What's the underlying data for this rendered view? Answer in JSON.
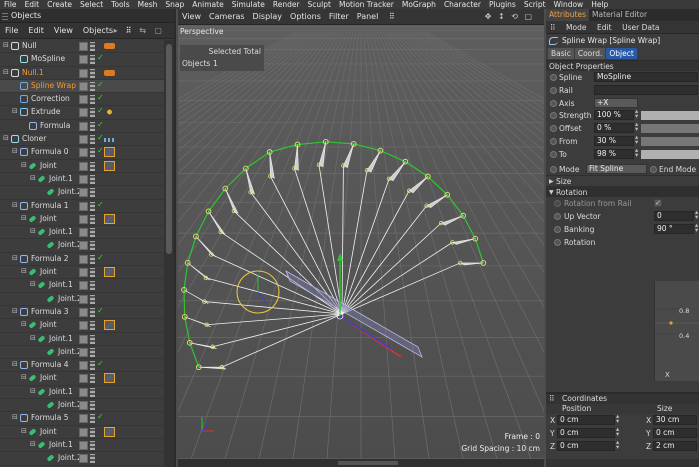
{
  "menubar": [
    "File",
    "Edit",
    "Create",
    "Select",
    "Tools",
    "Mesh",
    "Snap",
    "Animate",
    "Simulate",
    "Render",
    "Sculpt",
    "Motion Tracker",
    "MoGraph",
    "Character",
    "Plugins",
    "Script",
    "Window",
    "Help"
  ],
  "objects_panel": {
    "title": "Objects",
    "menu": [
      "File",
      "Edit",
      "View",
      "Objects"
    ],
    "rows": [
      {
        "label": "Null",
        "indent": 0,
        "icon": "null-icon",
        "expand": "-",
        "tag": "layer-tag",
        "check": false
      },
      {
        "label": "MoSpline",
        "indent": 1,
        "icon": "mospline-icon",
        "expand": "",
        "tag": "",
        "check": true
      },
      {
        "label": "Null.1",
        "indent": 0,
        "icon": "null-icon",
        "expand": "-",
        "tag": "layer-tag",
        "check": false,
        "orange": true
      },
      {
        "label": "Spline Wrap",
        "indent": 1,
        "icon": "spline-wrap-icon",
        "expand": "",
        "tag": "",
        "check": true,
        "orange": true,
        "selected": true
      },
      {
        "label": "Correction",
        "indent": 1,
        "icon": "correction-icon",
        "expand": "",
        "tag": "",
        "check": true
      },
      {
        "label": "Extrude",
        "indent": 1,
        "icon": "extrude-icon",
        "expand": "-",
        "tag": "phong-tag",
        "check": true
      },
      {
        "label": "Formula",
        "indent": 2,
        "icon": "formula-icon",
        "expand": "",
        "tag": "",
        "check": true
      },
      {
        "label": "Cloner",
        "indent": 0,
        "icon": "cloner-icon",
        "expand": "-",
        "tag": "mograph-tag",
        "check": true
      },
      {
        "label": "Formula 0",
        "indent": 1,
        "icon": "formula-icon",
        "expand": "-",
        "tag": "ik-tag",
        "check": true
      },
      {
        "label": "Joint",
        "indent": 2,
        "icon": "joint-icon",
        "expand": "-",
        "tag": "ik-tag",
        "check": false
      },
      {
        "label": "Joint.1",
        "indent": 3,
        "icon": "joint-icon",
        "expand": "-",
        "tag": "",
        "check": false
      },
      {
        "label": "Joint.2",
        "indent": 4,
        "icon": "joint-icon",
        "expand": "",
        "tag": "",
        "check": false
      },
      {
        "label": "Formula 1",
        "indent": 1,
        "icon": "formula-icon",
        "expand": "-",
        "tag": "",
        "check": true
      },
      {
        "label": "Joint",
        "indent": 2,
        "icon": "joint-icon",
        "expand": "-",
        "tag": "ik-tag",
        "check": false
      },
      {
        "label": "Joint.1",
        "indent": 3,
        "icon": "joint-icon",
        "expand": "-",
        "tag": "",
        "check": false
      },
      {
        "label": "Joint.2",
        "indent": 4,
        "icon": "joint-icon",
        "expand": "",
        "tag": "",
        "check": false
      },
      {
        "label": "Formula 2",
        "indent": 1,
        "icon": "formula-icon",
        "expand": "-",
        "tag": "",
        "check": true
      },
      {
        "label": "Joint",
        "indent": 2,
        "icon": "joint-icon",
        "expand": "-",
        "tag": "ik-tag",
        "check": false
      },
      {
        "label": "Joint.1",
        "indent": 3,
        "icon": "joint-icon",
        "expand": "-",
        "tag": "",
        "check": false
      },
      {
        "label": "Joint.2",
        "indent": 4,
        "icon": "joint-icon",
        "expand": "",
        "tag": "",
        "check": false
      },
      {
        "label": "Formula 3",
        "indent": 1,
        "icon": "formula-icon",
        "expand": "-",
        "tag": "",
        "check": true
      },
      {
        "label": "Joint",
        "indent": 2,
        "icon": "joint-icon",
        "expand": "-",
        "tag": "ik-tag",
        "check": false
      },
      {
        "label": "Joint.1",
        "indent": 3,
        "icon": "joint-icon",
        "expand": "-",
        "tag": "",
        "check": false
      },
      {
        "label": "Joint.2",
        "indent": 4,
        "icon": "joint-icon",
        "expand": "",
        "tag": "",
        "check": false
      },
      {
        "label": "Formula 4",
        "indent": 1,
        "icon": "formula-icon",
        "expand": "-",
        "tag": "",
        "check": true
      },
      {
        "label": "Joint",
        "indent": 2,
        "icon": "joint-icon",
        "expand": "-",
        "tag": "ik-tag",
        "check": false
      },
      {
        "label": "Joint.1",
        "indent": 3,
        "icon": "joint-icon",
        "expand": "-",
        "tag": "",
        "check": false
      },
      {
        "label": "Joint.2",
        "indent": 4,
        "icon": "joint-icon",
        "expand": "",
        "tag": "",
        "check": false
      },
      {
        "label": "Formula 5",
        "indent": 1,
        "icon": "formula-icon",
        "expand": "-",
        "tag": "",
        "check": true
      },
      {
        "label": "Joint",
        "indent": 2,
        "icon": "joint-icon",
        "expand": "-",
        "tag": "ik-tag",
        "check": false
      },
      {
        "label": "Joint.1",
        "indent": 3,
        "icon": "joint-icon",
        "expand": "-",
        "tag": "",
        "check": false
      },
      {
        "label": "Joint.2",
        "indent": 4,
        "icon": "joint-icon",
        "expand": "",
        "tag": "",
        "check": false
      }
    ]
  },
  "viewport": {
    "menu": [
      "View",
      "Cameras",
      "Display",
      "Options",
      "Filter",
      "Panel"
    ],
    "label": "Perspective",
    "hud_selected": "Selected Total",
    "hud_objects": "Objects",
    "hud_count": "1",
    "frame": "Frame : 0",
    "grid_spacing": "Grid Spacing : 10 cm"
  },
  "attributes": {
    "tabs": [
      "Attributes",
      "Material Editor"
    ],
    "menu": [
      "Mode",
      "Edit",
      "User Data"
    ],
    "title": "Spline Wrap [Spline Wrap]",
    "subtabs": [
      "Basic",
      "Coord.",
      "Object"
    ],
    "section": "Object Properties",
    "spline_label": "Spline",
    "spline_value": "MoSpline",
    "rail_label": "Rail",
    "axis_label": "Axis",
    "axis_value": "+X",
    "strength_label": "Strength",
    "strength_value": "100 %",
    "offset_label": "Offset",
    "offset_value": "0 %",
    "from_label": "From",
    "from_value": "30 %",
    "to_label": "To",
    "to_value": "98 %",
    "mode_label": "Mode",
    "mode_value": "Fit Spline",
    "end_mode_label": "End Mode",
    "size_label": "Size",
    "rotation_label": "Rotation",
    "rotation_from_rail_label": "Rotation from Rail",
    "up_vector_label": "Up Vector",
    "up_vector_value": "0",
    "banking_label": "Banking",
    "banking_value": "90 °",
    "rotation_curve_label": "Rotation",
    "graph_top": "0.8",
    "graph_mid": "0.4",
    "graph_x": "X"
  },
  "coordinates": {
    "title": "Coordinates",
    "position_label": "Position",
    "size_label": "Size",
    "rows": [
      {
        "axis": "X",
        "position": "0 cm",
        "size_axis": "X",
        "size": "30 cm"
      },
      {
        "axis": "Y",
        "position": "0 cm",
        "size_axis": "Y",
        "size": "0 cm"
      },
      {
        "axis": "Z",
        "position": "0 cm",
        "size_axis": "Z",
        "size": "2 cm"
      }
    ]
  }
}
